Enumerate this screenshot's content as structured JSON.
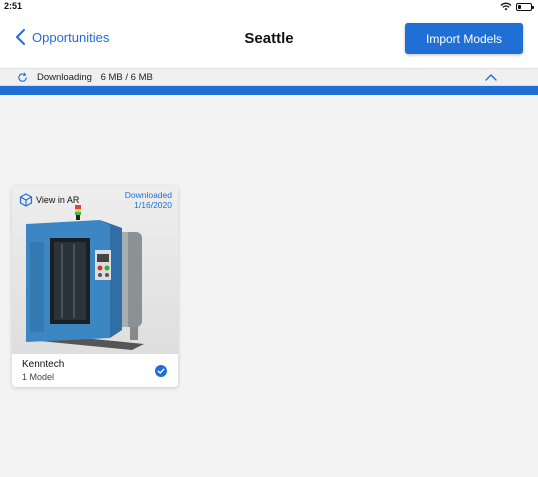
{
  "status_bar": {
    "time": "2:51"
  },
  "nav": {
    "back_label": "Opportunities",
    "title": "Seattle",
    "import_label": "Import Models"
  },
  "download": {
    "label": "Downloading",
    "size": "6 MB / 6 MB",
    "progress_fraction": 1.0
  },
  "models": [
    {
      "ar_label": "View in AR",
      "status_line1": "Downloaded",
      "status_line2": "1/16/2020",
      "name": "Kenntech",
      "count": "1 Model",
      "selected": true
    }
  ],
  "colors": {
    "accent": "#1f6fd6",
    "background": "#f3f3f3"
  },
  "icons": [
    "back-chevron-icon",
    "sync-icon",
    "chevron-up-icon",
    "ar-cube-icon",
    "check-circle-icon",
    "wifi-icon",
    "battery-icon"
  ]
}
